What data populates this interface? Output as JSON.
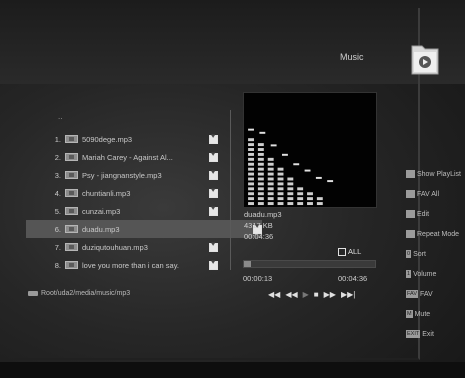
{
  "header": {
    "title": "Music"
  },
  "browser": {
    "parent_label": "..",
    "items": [
      {
        "num": "1.",
        "name": "5090dege.mp3"
      },
      {
        "num": "2.",
        "name": "Mariah Carey - Against Al..."
      },
      {
        "num": "3.",
        "name": "Psy - jiangnanstyle.mp3"
      },
      {
        "num": "4.",
        "name": "chuntianli.mp3"
      },
      {
        "num": "5.",
        "name": "cunzai.mp3"
      },
      {
        "num": "6.",
        "name": "duadu.mp3"
      },
      {
        "num": "7.",
        "name": "duziqutouhuan.mp3"
      },
      {
        "num": "8.",
        "name": "love you more than i can say."
      }
    ],
    "selected_index": 5,
    "path": "Root/uda2/media/music/mp3"
  },
  "player": {
    "file_name": "duadu.mp3",
    "file_size": "4317 KB",
    "duration": "00:04:36",
    "all_label": "ALL",
    "elapsed": "00:00:13",
    "total": "00:04:36",
    "progress_fraction": 0.05,
    "controls": {
      "prev": "◀◀",
      "rew": "◀◀",
      "play": "▶",
      "stop": "■",
      "ff": "▶▶",
      "next": "▶▶|"
    }
  },
  "menu": {
    "items": [
      {
        "key": "",
        "label": "Show PlayList"
      },
      {
        "key": "",
        "label": "FAV All"
      },
      {
        "key": "",
        "label": "Edit"
      },
      {
        "key": "",
        "label": "Repeat Mode"
      },
      {
        "key": "0",
        "label": "Sort"
      },
      {
        "key": "1",
        "label": "Volume"
      },
      {
        "key": "FAV",
        "label": "FAV"
      },
      {
        "key": "M",
        "label": "Mute"
      },
      {
        "key": "EXIT",
        "label": "Exit"
      }
    ]
  },
  "visualizer": {
    "bar_color": "#cfcfcf",
    "bars": [
      0.62,
      0.58,
      0.45,
      0.35,
      0.25,
      0.18,
      0.1,
      0.06
    ]
  }
}
